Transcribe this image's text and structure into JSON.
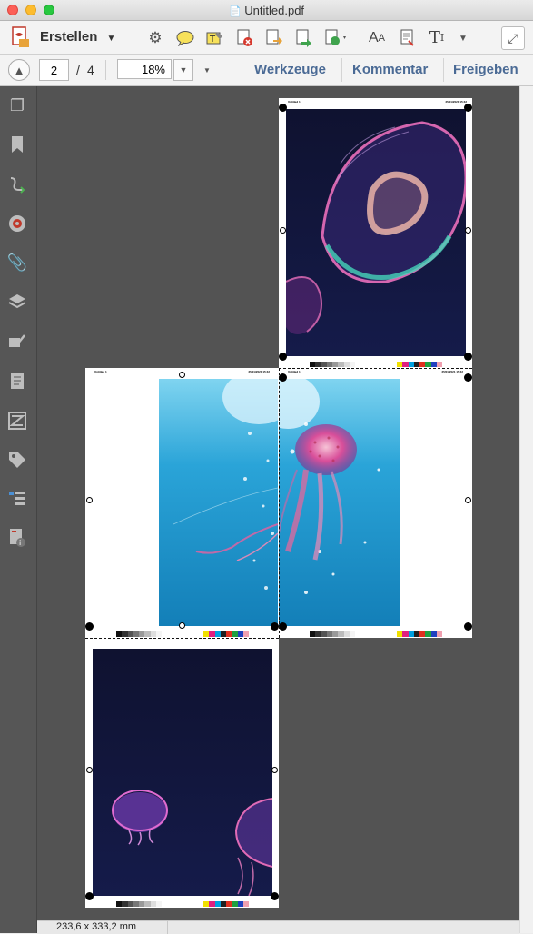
{
  "window": {
    "title": "Untitled.pdf"
  },
  "toolbar": {
    "create_label": "Erstellen",
    "tool_icons": [
      "gear-icon",
      "comment-icon",
      "highlight-icon",
      "delete-page-icon",
      "export-icon",
      "share-icon",
      "convert-icon",
      "text-size-icon",
      "edit-doc-icon",
      "text-tool-icon",
      "more-icon"
    ]
  },
  "nav": {
    "page_current": "2",
    "page_separator": "/",
    "page_total": "4",
    "zoom": "18%",
    "links": [
      "Werkzeuge",
      "Kommentar",
      "Freigeben"
    ]
  },
  "status": {
    "size": "233,6 x 333,2 mm"
  },
  "pages": {
    "header_left": "Untitled 1",
    "header_right": "25/01/2021 15:42"
  },
  "colors": {
    "canvas": "#535353",
    "sidebar": "#565656",
    "link": "#4a6a95"
  }
}
